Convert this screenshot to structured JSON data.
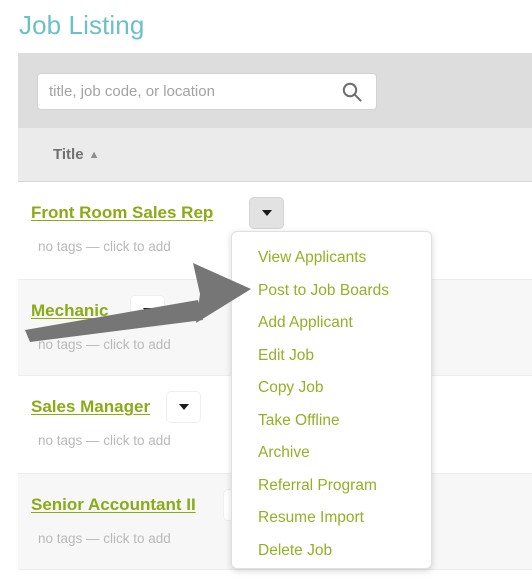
{
  "page": {
    "title": "Job Listing",
    "title_color": "#6cc0ca"
  },
  "search": {
    "placeholder": "title, job code, or location",
    "value": "",
    "icon": "search-icon"
  },
  "table": {
    "columns": [
      {
        "label": "Title",
        "sort_indicator": "▲",
        "sort_direction": "ascending"
      }
    ],
    "rows": [
      {
        "title": "Front Room Sales Rep",
        "tags_placeholder": "no tags — click to add",
        "menu_open": true,
        "caret_icon": "chevron-down-icon"
      },
      {
        "title": "Mechanic",
        "tags_placeholder": "no tags — click to add",
        "menu_open": false,
        "caret_icon": "chevron-down-icon"
      },
      {
        "title": "Sales Manager",
        "tags_placeholder": "no tags — click to add",
        "menu_open": false,
        "caret_icon": "chevron-down-icon"
      },
      {
        "title": "Senior Accountant II",
        "tags_placeholder": "no tags — click to add",
        "menu_open": false,
        "caret_icon": "chevron-down-icon"
      }
    ],
    "link_color": "#8bab15",
    "row_alt_background": "#f7f7f7"
  },
  "dropdown_menu": {
    "owner_row": "Front Room Sales Rep",
    "item_color": "#93b027",
    "items": [
      {
        "label": "View Applicants"
      },
      {
        "label": "Post to Job Boards"
      },
      {
        "label": "Add Applicant"
      },
      {
        "label": "Edit Job"
      },
      {
        "label": "Copy Job"
      },
      {
        "label": "Take Offline"
      },
      {
        "label": "Archive"
      },
      {
        "label": "Referral Program"
      },
      {
        "label": "Resume Import"
      },
      {
        "label": "Delete Job"
      }
    ]
  },
  "annotation": {
    "type": "arrow",
    "color": "#767676",
    "points_to": "Post to Job Boards"
  }
}
